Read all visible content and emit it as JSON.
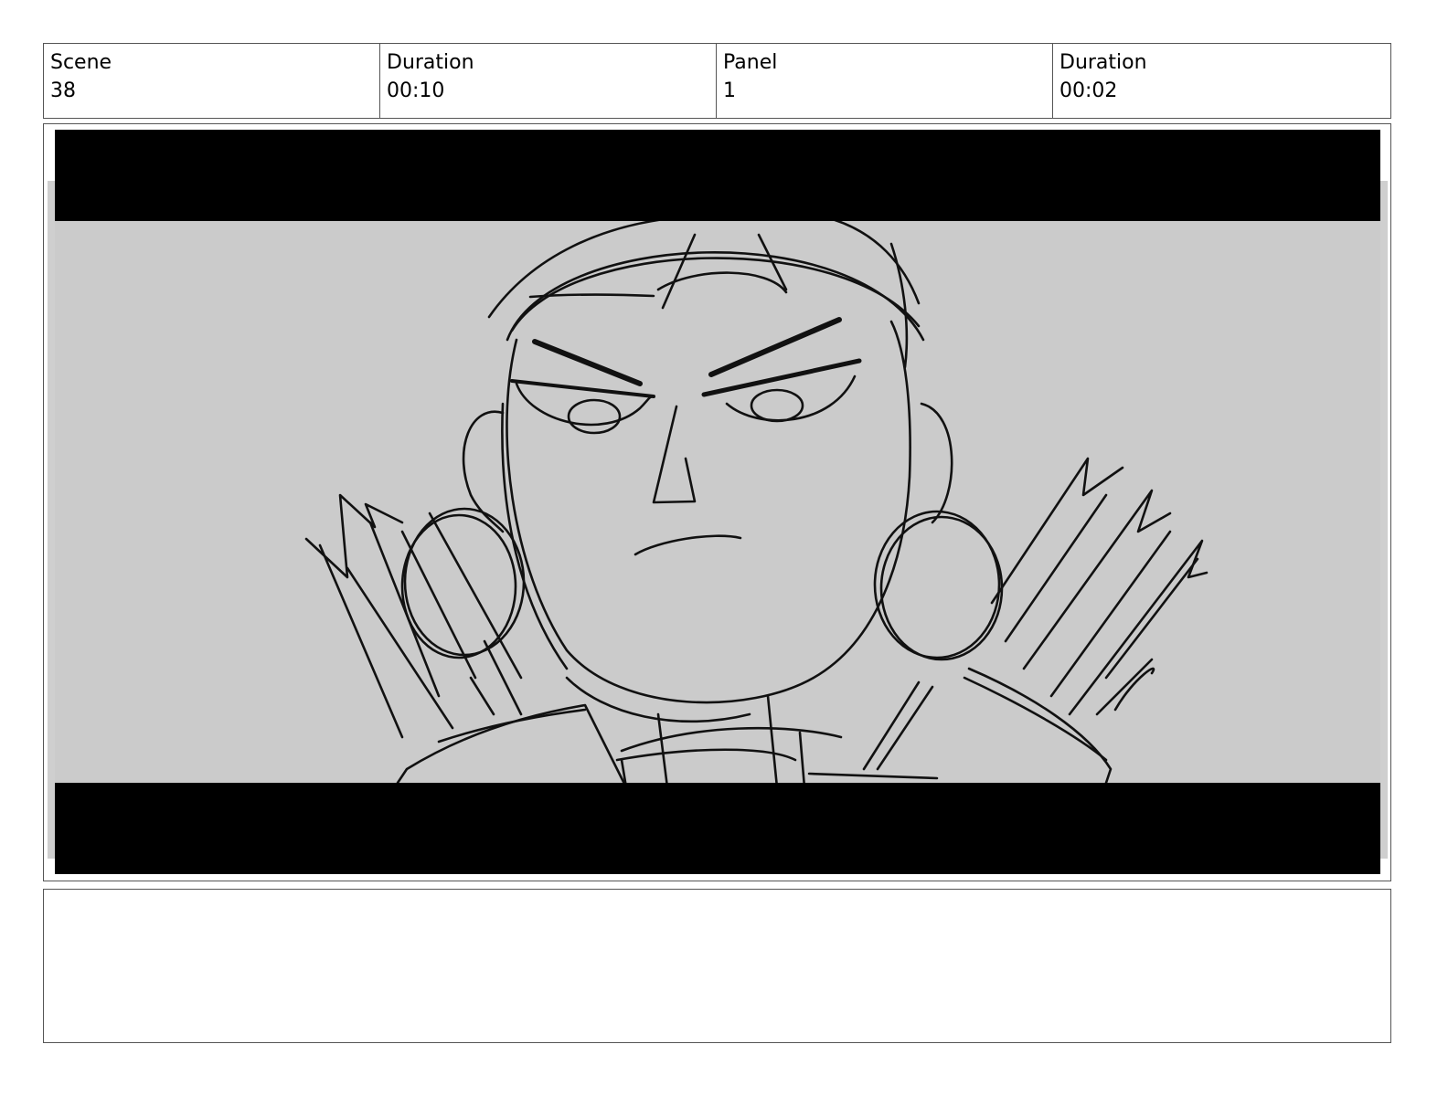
{
  "header": {
    "scene_label": "Scene",
    "scene_value": "38",
    "scene_duration_label": "Duration",
    "scene_duration_value": "00:10",
    "panel_label": "Panel",
    "panel_value": "1",
    "panel_duration_label": "Duration",
    "panel_duration_value": "00:02"
  },
  "frame": {
    "letterbox_color": "#000000",
    "background_color": "#cbcbcb",
    "line_color": "#111111"
  },
  "notes": {
    "text": ""
  }
}
